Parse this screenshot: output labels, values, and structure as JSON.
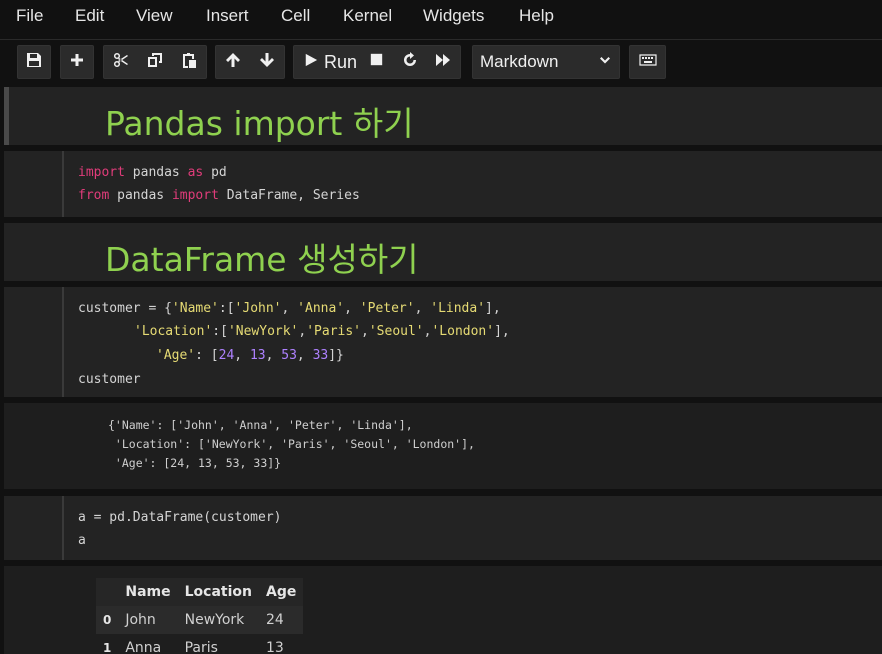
{
  "menu": [
    "File",
    "Edit",
    "View",
    "Insert",
    "Cell",
    "Kernel",
    "Widgets",
    "Help"
  ],
  "toolbar": {
    "run_label": "Run",
    "cell_type": "Markdown",
    "icons": [
      "save-icon",
      "add-icon",
      "cut-icon",
      "copy-icon",
      "paste-icon",
      "arrow-up-icon",
      "arrow-down-icon",
      "play-icon",
      "stop-icon",
      "restart-icon",
      "fast-forward-icon",
      "keyboard-icon"
    ]
  },
  "cells": {
    "md1": "Pandas import 하기",
    "code1": {
      "l1": [
        "import",
        " pandas ",
        "as",
        " pd"
      ],
      "l2": [
        "from",
        " pandas ",
        "import",
        " DataFrame, Series"
      ]
    },
    "md2": "DataFrame 생성하기",
    "code2": {
      "l1a": "customer = {",
      "l1b": "'Name'",
      "l1c": ":[",
      "l1d": "'John'",
      "l1e": ", ",
      "l1f": "'Anna'",
      "l1g": ", ",
      "l1h": "'Peter'",
      "l1i": ", ",
      "l1j": "'Linda'",
      "l1k": "],",
      "l2a": "'Location'",
      "l2b": ":[",
      "l2c": "'NewYork'",
      "l2d": ",",
      "l2e": "'Paris'",
      "l2f": ",",
      "l2g": "'Seoul'",
      "l2h": ",",
      "l2i": "'London'",
      "l2j": "],",
      "l3a": "'Age'",
      "l3b": ": [",
      "l3c": "24",
      "l3d": ", ",
      "l3e": "13",
      "l3f": ", ",
      "l3g": "53",
      "l3h": ", ",
      "l3i": "33",
      "l3j": "]}",
      "l4": "customer"
    },
    "out2": {
      "l1": "{'Name': ['John', 'Anna', 'Peter', 'Linda'],",
      "l2": " 'Location': ['NewYork', 'Paris', 'Seoul', 'London'],",
      "l3": " 'Age': [24, 13, 53, 33]}"
    },
    "code3": {
      "l1": "a = pd.DataFrame(customer)",
      "l2": "a"
    },
    "table": {
      "headers": [
        "",
        "Name",
        "Location",
        "Age"
      ],
      "rows": [
        [
          "0",
          "John",
          "NewYork",
          "24"
        ],
        [
          "1",
          "Anna",
          "Paris",
          "13"
        ]
      ]
    }
  },
  "colors": {
    "markdown_heading": "#8fd14f",
    "keyword": "#e03c7a",
    "string": "#e6db74",
    "number": "#ae81ff"
  }
}
